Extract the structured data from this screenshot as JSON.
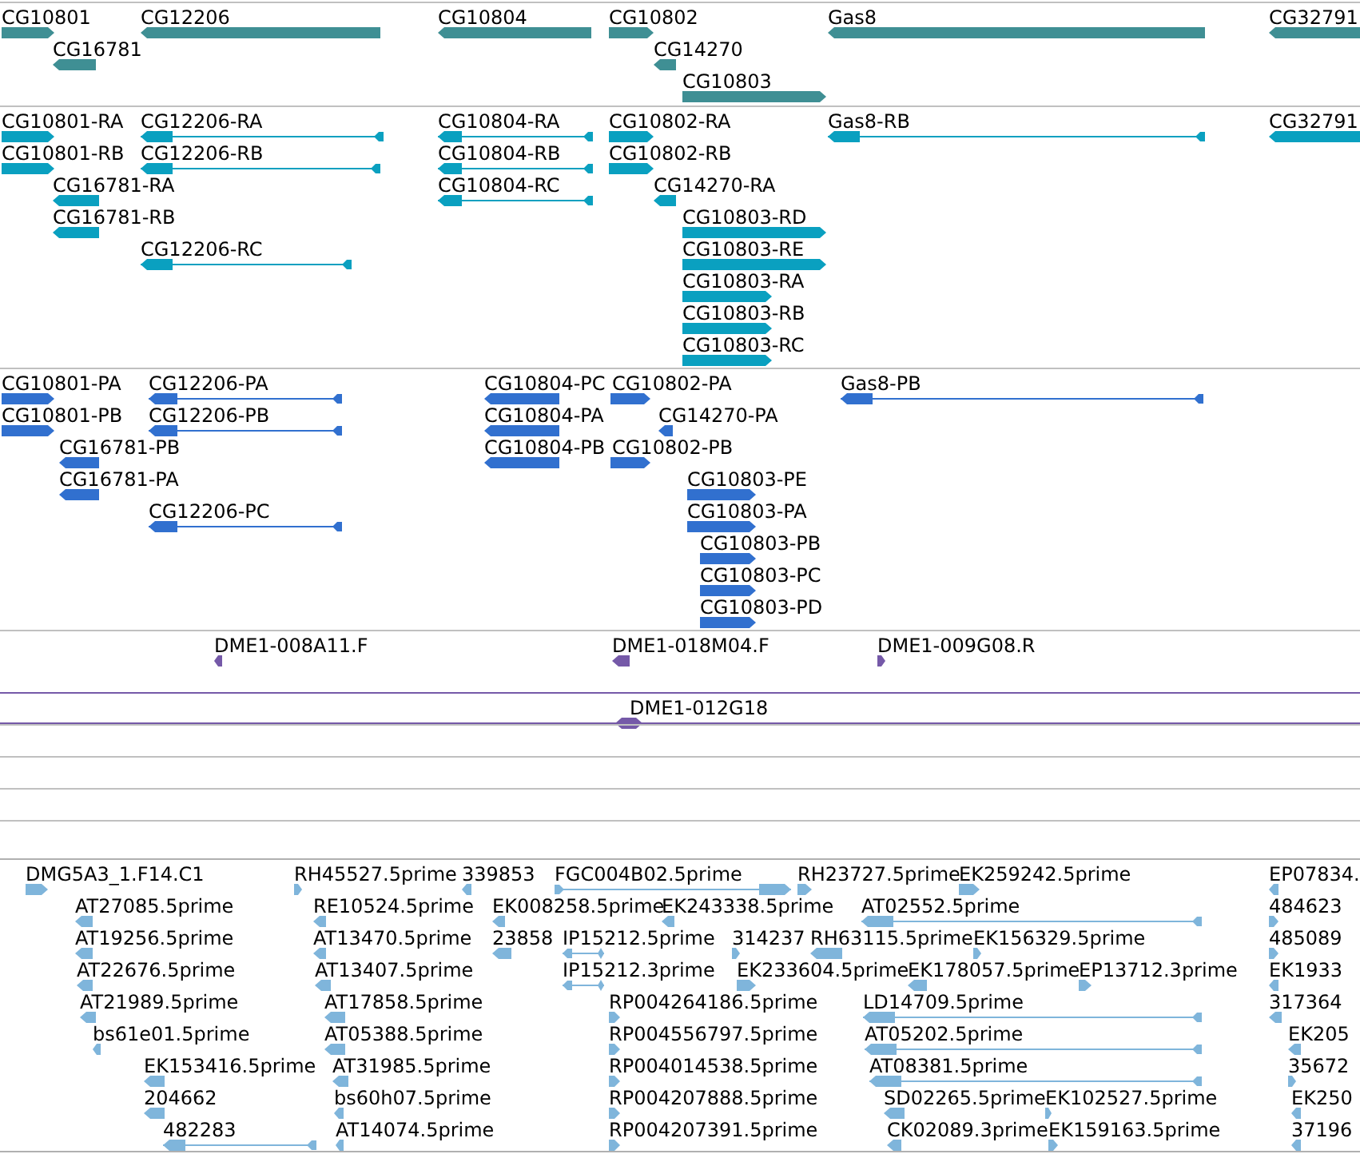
{
  "tracks": [
    {
      "kind": "gene",
      "features": [
        {
          "label": "CG10801",
          "kind": "forward"
        },
        {
          "label": "CG12206",
          "kind": "reverse"
        },
        {
          "label": "CG16781",
          "kind": "reverse"
        },
        {
          "label": "CG10804",
          "kind": "reverse"
        },
        {
          "label": "CG10802",
          "kind": "forward"
        },
        {
          "label": "CG14270",
          "kind": "reverse"
        },
        {
          "label": "CG10803",
          "kind": "forward"
        },
        {
          "label": "Gas8",
          "kind": "reverse"
        },
        {
          "label": "CG32791",
          "kind": "reverse"
        }
      ]
    },
    {
      "kind": "transcript",
      "features": [
        {
          "label": "CG10801-RA",
          "kind": "forward"
        },
        {
          "label": "CG10801-RB",
          "kind": "forward"
        },
        {
          "label": "CG12206-RA",
          "kind": "reverse"
        },
        {
          "label": "CG12206-RB",
          "kind": "reverse"
        },
        {
          "label": "CG16781-RA",
          "kind": "reverse"
        },
        {
          "label": "CG16781-RB",
          "kind": "reverse"
        },
        {
          "label": "CG12206-RC",
          "kind": "reverse"
        },
        {
          "label": "CG10804-RA",
          "kind": "reverse"
        },
        {
          "label": "CG10804-RB",
          "kind": "reverse"
        },
        {
          "label": "CG10804-RC",
          "kind": "reverse"
        },
        {
          "label": "CG10802-RA",
          "kind": "forward"
        },
        {
          "label": "CG10802-RB",
          "kind": "forward"
        },
        {
          "label": "CG14270-RA",
          "kind": "reverse"
        },
        {
          "label": "CG10803-RD",
          "kind": "forward"
        },
        {
          "label": "CG10803-RE",
          "kind": "forward"
        },
        {
          "label": "CG10803-RA",
          "kind": "forward"
        },
        {
          "label": "CG10803-RB",
          "kind": "forward"
        },
        {
          "label": "CG10803-RC",
          "kind": "forward"
        },
        {
          "label": "Gas8-RB",
          "kind": "reverse"
        },
        {
          "label": "CG32791",
          "kind": "reverse"
        }
      ]
    },
    {
      "kind": "protein",
      "features": [
        {
          "label": "CG10801-PA",
          "kind": "forward"
        },
        {
          "label": "CG10801-PB",
          "kind": "forward"
        },
        {
          "label": "CG12206-PA",
          "kind": "reverse"
        },
        {
          "label": "CG12206-PB",
          "kind": "reverse"
        },
        {
          "label": "CG16781-PB",
          "kind": "reverse"
        },
        {
          "label": "CG16781-PA",
          "kind": "reverse"
        },
        {
          "label": "CG12206-PC",
          "kind": "reverse"
        },
        {
          "label": "CG10804-PC",
          "kind": "reverse"
        },
        {
          "label": "CG10804-PA",
          "kind": "reverse"
        },
        {
          "label": "CG10804-PB",
          "kind": "reverse"
        },
        {
          "label": "CG10802-PA",
          "kind": "forward"
        },
        {
          "label": "CG14270-PA",
          "kind": "reverse"
        },
        {
          "label": "CG10802-PB",
          "kind": "forward"
        },
        {
          "label": "CG10803-PE",
          "kind": "forward"
        },
        {
          "label": "CG10803-PA",
          "kind": "forward"
        },
        {
          "label": "CG10803-PB",
          "kind": "forward"
        },
        {
          "label": "CG10803-PC",
          "kind": "forward"
        },
        {
          "label": "CG10803-PD",
          "kind": "forward"
        },
        {
          "label": "Gas8-PB",
          "kind": "reverse"
        }
      ]
    },
    {
      "kind": "clone_end",
      "features": [
        {
          "label": "DME1-008A11.F",
          "kind": "reverse"
        },
        {
          "label": "DME1-018M04.F",
          "kind": "reverse"
        },
        {
          "label": "DME1-009G08.R",
          "kind": "forward"
        }
      ]
    },
    {
      "kind": "clone",
      "features": [
        {
          "label": "DME1-012G18",
          "kind": "bidirectional"
        }
      ]
    },
    {
      "kind": "empty"
    },
    {
      "kind": "empty"
    },
    {
      "kind": "empty"
    },
    {
      "kind": "empty"
    },
    {
      "kind": "est",
      "features": [
        {
          "label": "DMG5A3_1.F14.C1",
          "kind": "forward"
        },
        {
          "label": "RH45527.5prime",
          "kind": "forward"
        },
        {
          "label": "339853",
          "kind": "reverse"
        },
        {
          "label": "FGC004B02.5prime",
          "kind": "forward"
        },
        {
          "label": "RH23727.5prime",
          "kind": "forward"
        },
        {
          "label": "EK259242.5prime",
          "kind": "forward"
        },
        {
          "label": "EP07834.",
          "kind": "reverse"
        },
        {
          "label": "AT27085.5prime",
          "kind": "reverse"
        },
        {
          "label": "RE10524.5prime",
          "kind": "reverse"
        },
        {
          "label": "EK008258.5prime",
          "kind": "reverse"
        },
        {
          "label": "EK243338.5prime",
          "kind": "reverse"
        },
        {
          "label": "AT02552.5prime",
          "kind": "reverse"
        },
        {
          "label": "484623",
          "kind": "forward"
        },
        {
          "label": "AT19256.5prime",
          "kind": "reverse"
        },
        {
          "label": "AT13470.5prime",
          "kind": "reverse"
        },
        {
          "label": "23858",
          "kind": "reverse"
        },
        {
          "label": "IP15212.5prime",
          "kind": "bidirectional"
        },
        {
          "label": "314237",
          "kind": "forward"
        },
        {
          "label": "RH63115.5prime",
          "kind": "reverse"
        },
        {
          "label": "EK156329.5prime",
          "kind": "forward"
        },
        {
          "label": "485089",
          "kind": "forward"
        },
        {
          "label": "AT22676.5prime",
          "kind": "reverse"
        },
        {
          "label": "AT13407.5prime",
          "kind": "reverse"
        },
        {
          "label": "IP15212.3prime",
          "kind": "bidirectional"
        },
        {
          "label": "EK233604.5prime",
          "kind": "forward"
        },
        {
          "label": "EK178057.5prime",
          "kind": "reverse"
        },
        {
          "label": "EP13712.3prime",
          "kind": "forward"
        },
        {
          "label": "EK1933",
          "kind": "reverse"
        },
        {
          "label": "AT21989.5prime",
          "kind": "reverse"
        },
        {
          "label": "AT17858.5prime",
          "kind": "reverse"
        },
        {
          "label": "RP004264186.5prime",
          "kind": "forward"
        },
        {
          "label": "LD14709.5prime",
          "kind": "reverse"
        },
        {
          "label": "317364",
          "kind": "reverse"
        },
        {
          "label": "bs61e01.5prime",
          "kind": "reverse"
        },
        {
          "label": "AT05388.5prime",
          "kind": "reverse"
        },
        {
          "label": "RP004556797.5prime",
          "kind": "forward"
        },
        {
          "label": "AT05202.5prime",
          "kind": "reverse"
        },
        {
          "label": "EK205",
          "kind": "reverse"
        },
        {
          "label": "EK153416.5prime",
          "kind": "reverse"
        },
        {
          "label": "AT31985.5prime",
          "kind": "reverse"
        },
        {
          "label": "RP004014538.5prime",
          "kind": "forward"
        },
        {
          "label": "AT08381.5prime",
          "kind": "reverse"
        },
        {
          "label": "35672",
          "kind": "forward"
        },
        {
          "label": "204662",
          "kind": "reverse"
        },
        {
          "label": "bs60h07.5prime",
          "kind": "reverse"
        },
        {
          "label": "RP004207888.5prime",
          "kind": "forward"
        },
        {
          "label": "SD02265.5prime",
          "kind": "reverse"
        },
        {
          "label": "EK102527.5prime",
          "kind": "forward"
        },
        {
          "label": "EK250",
          "kind": "reverse"
        },
        {
          "label": "482283",
          "kind": "reverse"
        },
        {
          "label": "AT14074.5prime",
          "kind": "reverse"
        },
        {
          "label": "RP004207391.5prime",
          "kind": "forward"
        },
        {
          "label": "CK02089.3prime",
          "kind": "reverse"
        },
        {
          "label": "EK159163.5prime",
          "kind": "forward"
        },
        {
          "label": "37196",
          "kind": "reverse"
        }
      ]
    }
  ]
}
